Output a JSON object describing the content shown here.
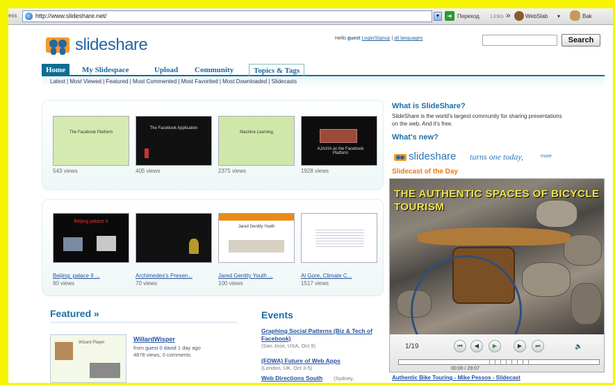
{
  "browser": {
    "address_label": "ess",
    "url": "http://www.slideshare.net/",
    "toolbar_translate": "Переход",
    "toolbar_links": "Links",
    "toolbar_chevron": "»",
    "toolbar_item1": "WebSlab",
    "toolbar_item2": "Bak"
  },
  "header": {
    "logo_text": "slideshare",
    "hello_prefix": "Hello",
    "username": "guest",
    "login_link": "Login/Signup",
    "all_languages": "all languages",
    "search_button": "Search",
    "search_placeholder": ""
  },
  "nav": {
    "tabs": [
      "Home",
      "My Slidespace",
      "Upload",
      "Community",
      "Topics & Tags"
    ],
    "subnav": "Latest | Most Viewed | Featured | Most Commented | Most Favorited | Most Downloaded | Slidecasts"
  },
  "row1": [
    {
      "views": "543 views"
    },
    {
      "views": "405 views"
    },
    {
      "views": "2375 views"
    },
    {
      "views": "1928 views"
    }
  ],
  "row2": [
    {
      "title": "Beijing: palace II ...",
      "views": "90 views"
    },
    {
      "title": "Archimedes's Presen...",
      "views": "70 views"
    },
    {
      "title": "Jared Genitty Youth ...",
      "views": "100 views"
    },
    {
      "title": "Al Gore, Climate C...",
      "views": "1517 views"
    }
  ],
  "thumb_texts": {
    "t1": "The Facebook Platform",
    "t2": "The Facebook Application",
    "t3": "Machine Learning",
    "t4": "AJAXIA on the Facebook Platform",
    "r2t1": "Beijing palace II",
    "r2t3": "Jared Genitty Youth"
  },
  "right": {
    "what_is_heading": "What is SlideShare?",
    "what_is_text": "SlideShare is the world's largest community for sharing presentations on the web. And it's free.",
    "whats_new_heading": "What's new?",
    "anniv_logo": "slideshare",
    "anniv_text": "turns one today,",
    "anniv_more": "more",
    "sotd_heading": "Slidecast of the Day",
    "slide_title": "THE AUTHENTIC SPACES OF BICYCLE TOURISM",
    "slide_count": "1/19",
    "time": "00:00 / 29:07",
    "sotd_link": "Authentic Bike Touring - Mike Pessos - Slidecast"
  },
  "featured": {
    "heading": "Featured »",
    "title": "WillardWisper",
    "from_prefix": "from",
    "from_user": "guest 0 david",
    "from_suffix": "1 day ago",
    "meta": "4878 views, 0 comments",
    "thumb_text": "Wizard Player"
  },
  "events": {
    "heading": "Events",
    "items": [
      {
        "title": "Graphing Social Patterns (Biz & Tech of Facebook)",
        "meta": "(San Jose, USA, Oct 9)"
      },
      {
        "title": "(FOWA) Future of Web Apps",
        "meta": "(London, UK, Oct 3-5)"
      },
      {
        "title": "Web Directions South",
        "meta": "(Sydney,"
      }
    ]
  },
  "colors": {
    "accent": "#1b6fa6",
    "nav": "#0f6d93",
    "orange": "#e47b18",
    "frame": "#f5f500"
  }
}
